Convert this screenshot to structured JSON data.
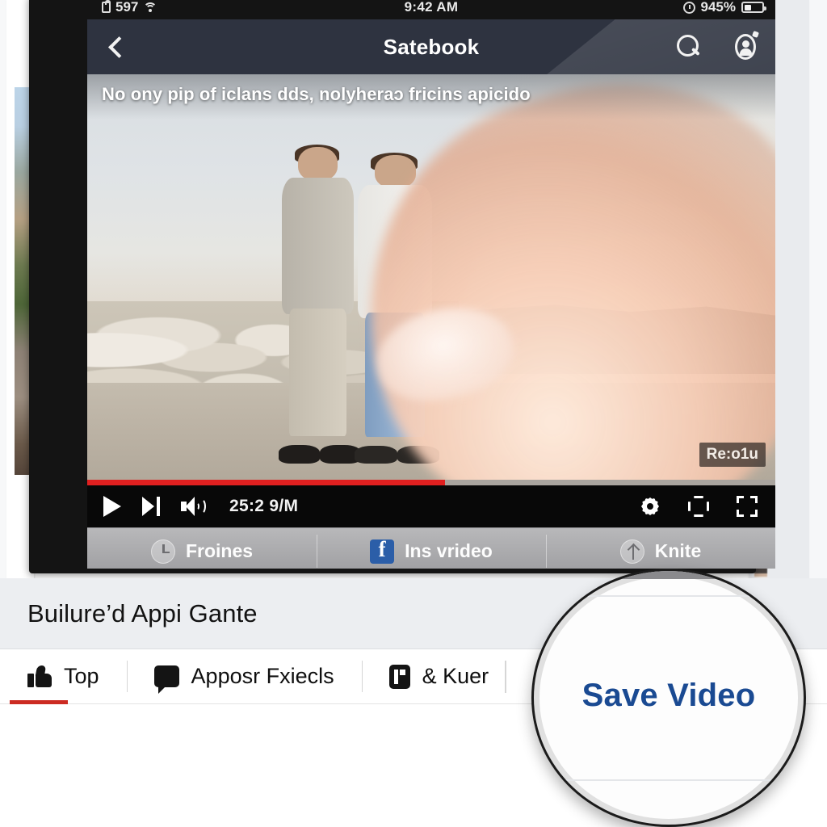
{
  "status_bar": {
    "carrier_text": "597",
    "lock_icon": "lock-icon",
    "wifi_icon": "wifi-icon",
    "time": "9:42 AM",
    "alarm_icon": "alarm-icon",
    "battery_percent": "945%",
    "battery_icon": "battery-icon"
  },
  "nav_bar": {
    "back_icon": "chevron-left-icon",
    "title": "Satebook",
    "search_icon": "search-icon",
    "account_icon": "account-icon"
  },
  "video": {
    "caption": "No ony pip of iclans dds, nolyheraɔ fricins apicido",
    "resolution_badge": "Re:o1u",
    "scene_description": "Two men facing each other on a rocky seaside path at sunset, with a blurred fingertip tapping the screen"
  },
  "player": {
    "progress_percent": 52,
    "progress_color": "#e02020",
    "play_icon": "play-icon",
    "next_icon": "next-track-icon",
    "volume_icon": "volume-icon",
    "time_label": "25:2 9/M",
    "settings_icon": "gear-icon",
    "miniplayer_icon": "miniplayer-icon",
    "fullscreen_icon": "fullscreen-icon"
  },
  "action_row": {
    "items": [
      {
        "icon": "watch-later-icon",
        "label": "Froines"
      },
      {
        "icon": "facebook-icon",
        "label": "Ins vrideo"
      },
      {
        "icon": "share-upload-icon",
        "label": "Knite"
      }
    ]
  },
  "page": {
    "video_title": "Builure’d Appi Gante",
    "tabs": [
      {
        "icon": "thumbs-up-icon",
        "label": "Top",
        "active": true
      },
      {
        "icon": "comment-icon",
        "label": "Apposr Fxiecls",
        "active": false
      },
      {
        "icon": "card-icon",
        "label": "& Kuer",
        "active": false
      }
    ],
    "active_tab_underline_color": "#cc2b22"
  },
  "magnifier": {
    "label": "Save Video",
    "label_color": "#1a4a92"
  }
}
